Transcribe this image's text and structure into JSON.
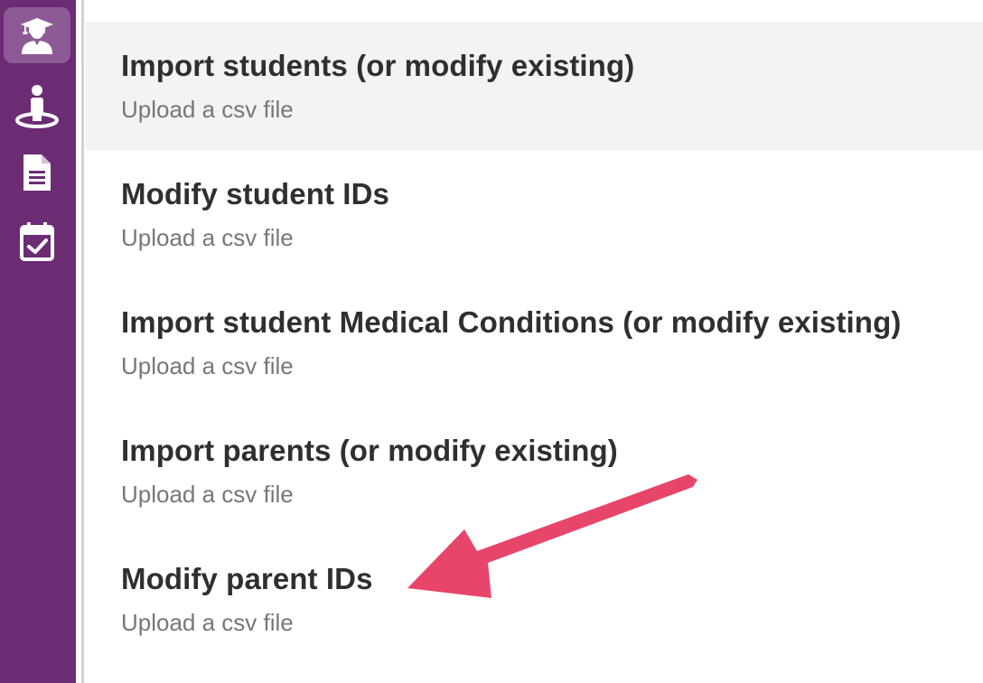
{
  "sidebar": {
    "items": [
      {
        "icon": "student-graduate-icon",
        "active": true
      },
      {
        "icon": "person-pin-icon",
        "active": false
      },
      {
        "icon": "document-icon",
        "active": false
      },
      {
        "icon": "calendar-check-icon",
        "active": false
      }
    ],
    "colors": {
      "background": "#6b2c74",
      "active": "#8e5a96"
    }
  },
  "import_options": [
    {
      "title": "Import students (or modify existing)",
      "subtitle": "Upload a csv file"
    },
    {
      "title": "Modify student IDs",
      "subtitle": "Upload a csv file"
    },
    {
      "title": "Import student Medical Conditions (or modify existing)",
      "subtitle": "Upload a csv file"
    },
    {
      "title": "Import parents (or modify existing)",
      "subtitle": "Upload a csv file"
    },
    {
      "title": "Modify parent IDs",
      "subtitle": "Upload a csv file"
    }
  ],
  "annotation": {
    "type": "arrow",
    "color": "#e8456b",
    "points_to": "Modify parent IDs"
  }
}
